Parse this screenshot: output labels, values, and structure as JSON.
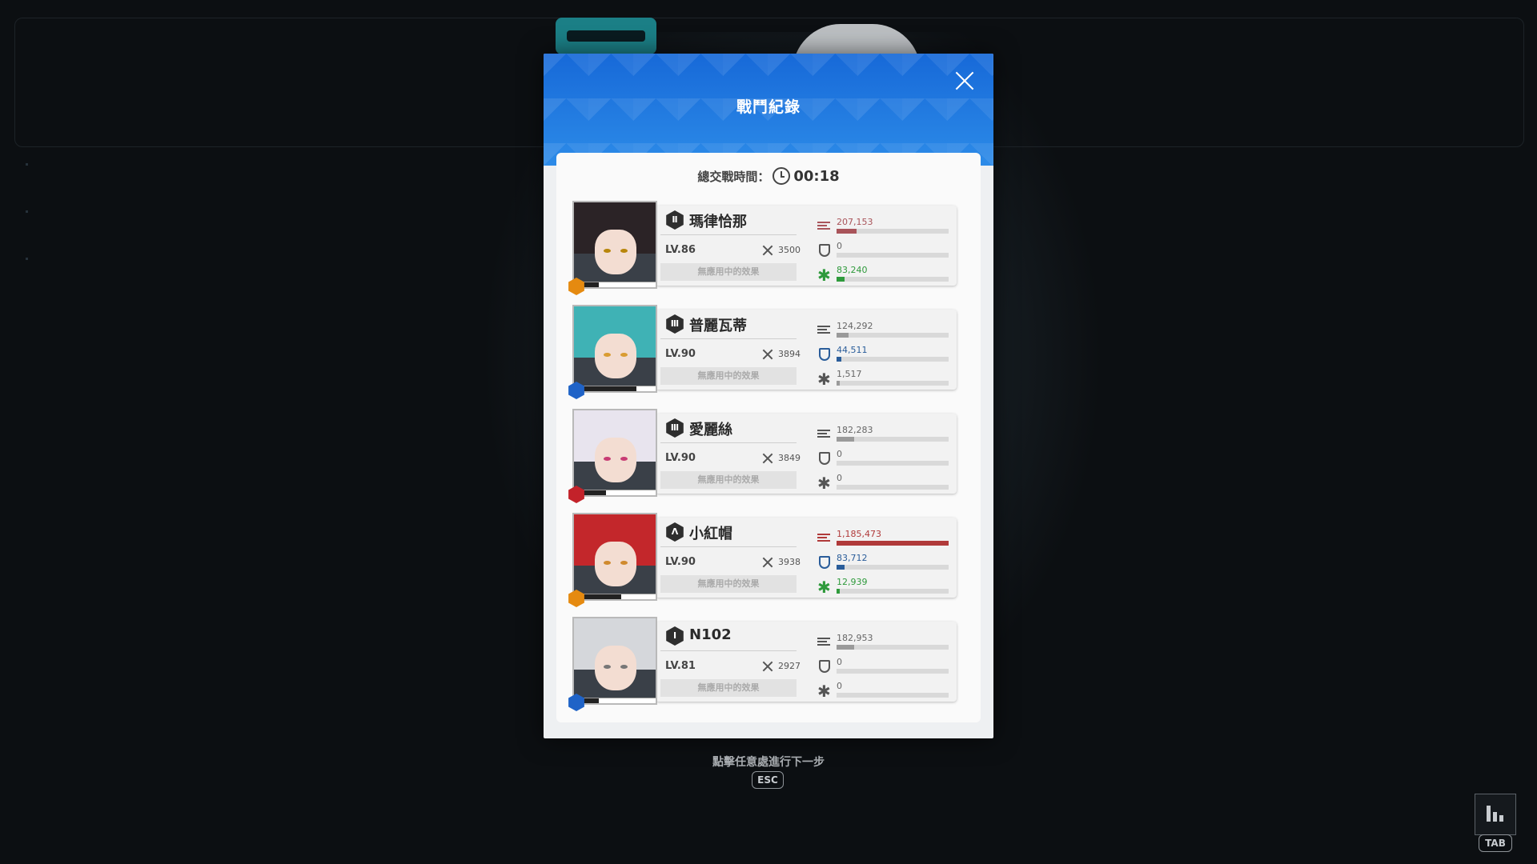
{
  "modal": {
    "title": "戰鬥紀錄",
    "total_label": "總交戰時間：",
    "total_time": "00:18"
  },
  "characters": [
    {
      "name": "瑪律恰那",
      "rank": "Ⅱ",
      "level": "LV.86",
      "power": "3500",
      "effect": "無應用中的效果",
      "element_icon": "hex-orange-icon",
      "stats": {
        "damage": "207,153",
        "shield": "0",
        "heal": "83,240"
      },
      "stat_ratios": {
        "damage": 0.18,
        "shield": 0,
        "heal": 0.07
      },
      "highlight": {
        "damage": "#a9545a",
        "shield": "#666666",
        "heal": "#2f9a3c"
      }
    },
    {
      "name": "普麗瓦蒂",
      "rank": "Ⅲ",
      "level": "LV.90",
      "power": "3894",
      "effect": "無應用中的效果",
      "element_icon": "hex-blue-icon",
      "stats": {
        "damage": "124,292",
        "shield": "44,511",
        "heal": "1,517"
      },
      "stat_ratios": {
        "damage": 0.11,
        "shield": 0.04,
        "heal": 0.01
      },
      "highlight": {
        "damage": "#666666",
        "shield": "#2a5d9a",
        "heal": "#666666"
      }
    },
    {
      "name": "愛麗絲",
      "rank": "Ⅲ",
      "level": "LV.90",
      "power": "3849",
      "effect": "無應用中的效果",
      "element_icon": "hex-red-icon",
      "stats": {
        "damage": "182,283",
        "shield": "0",
        "heal": "0"
      },
      "stat_ratios": {
        "damage": 0.16,
        "shield": 0,
        "heal": 0
      },
      "highlight": {
        "damage": "#666666",
        "shield": "#666666",
        "heal": "#666666"
      }
    },
    {
      "name": "小紅帽",
      "rank": "Λ",
      "level": "LV.90",
      "power": "3938",
      "effect": "無應用中的效果",
      "element_icon": "hex-orange-icon",
      "stats": {
        "damage": "1,185,473",
        "shield": "83,712",
        "heal": "12,939"
      },
      "stat_ratios": {
        "damage": 1.0,
        "shield": 0.07,
        "heal": 0.01
      },
      "highlight": {
        "damage": "#b03a3a",
        "shield": "#2a5d9a",
        "heal": "#2f9a3c"
      }
    },
    {
      "name": "N102",
      "rank": "Ⅰ",
      "level": "LV.81",
      "power": "2927",
      "effect": "無應用中的效果",
      "element_icon": "hex-blue-icon",
      "stats": {
        "damage": "182,953",
        "shield": "0",
        "heal": "0"
      },
      "stat_ratios": {
        "damage": 0.16,
        "shield": 0,
        "heal": 0
      },
      "highlight": {
        "damage": "#666666",
        "shield": "#666666",
        "heal": "#666666"
      }
    }
  ],
  "footer": {
    "hint": "點擊任意處進行下一步",
    "esc_key": "ESC",
    "tab_key": "TAB"
  }
}
